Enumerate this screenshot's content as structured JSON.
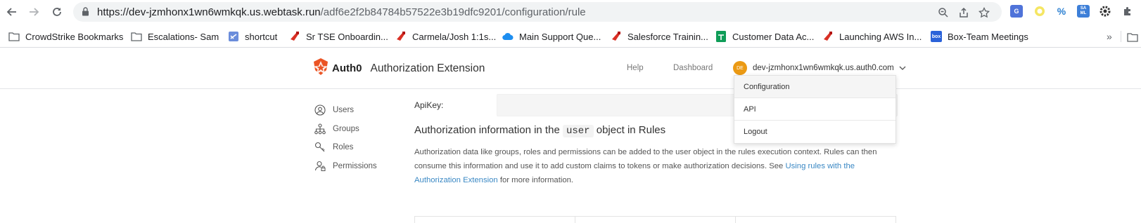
{
  "browser": {
    "url_host": "https://dev-jzmhonx1wn6wmkqk.us.webtask.run",
    "url_path": "/adf6e2f2b84784b57522e3b19dfc9201/configuration/rule",
    "bookmarks": [
      {
        "label": "CrowdStrike Bookmarks",
        "icon": "folder-icon"
      },
      {
        "label": "Escalations- Sam",
        "icon": "folder-icon"
      },
      {
        "label": "shortcut",
        "icon": "shortcut-icon"
      },
      {
        "label": "Sr TSE Onboardin...",
        "icon": "salesforce-icon"
      },
      {
        "label": "Carmela/Josh 1:1s...",
        "icon": "salesforce-icon"
      },
      {
        "label": "Main Support Que...",
        "icon": "cloud-icon"
      },
      {
        "label": "Salesforce Trainin...",
        "icon": "salesforce-icon"
      },
      {
        "label": "Customer Data Ac...",
        "icon": "sheets-icon"
      },
      {
        "label": "Launching AWS In...",
        "icon": "salesforce-icon"
      },
      {
        "label": "Box-Team Meetings",
        "icon": "box-icon"
      }
    ],
    "more": "»",
    "ext_saml": "SA ML",
    "ext_box": "box"
  },
  "header": {
    "brand": "Auth0",
    "title": "Authorization Extension",
    "help": "Help",
    "dashboard": "Dashboard",
    "avatar_initials": "DE",
    "tenant": "dev-jzmhonx1wn6wmkqk.us.auth0.com"
  },
  "sidebar": {
    "items": [
      {
        "label": "Users"
      },
      {
        "label": "Groups"
      },
      {
        "label": "Roles"
      },
      {
        "label": "Permissions"
      }
    ]
  },
  "main": {
    "apikey_label": "ApiKey:",
    "heading_pre": "Authorization information in the",
    "heading_code": "user",
    "heading_post": "object in Rules",
    "para_text": "Authorization data like groups, roles and permissions can be added to the user object in the rules execution context. Rules can then consume this information and use it to add custom claims to tokens or make authorization decisions. See ",
    "para_link": "Using rules with the Authorization Extension",
    "para_end": " for more information."
  },
  "dropdown": {
    "items": [
      {
        "label": "Configuration"
      },
      {
        "label": "API"
      },
      {
        "label": "Logout"
      }
    ]
  },
  "colors": {
    "auth0_orange": "#eb5424",
    "avatar": "#eb9a14",
    "link": "#3a88c4"
  }
}
